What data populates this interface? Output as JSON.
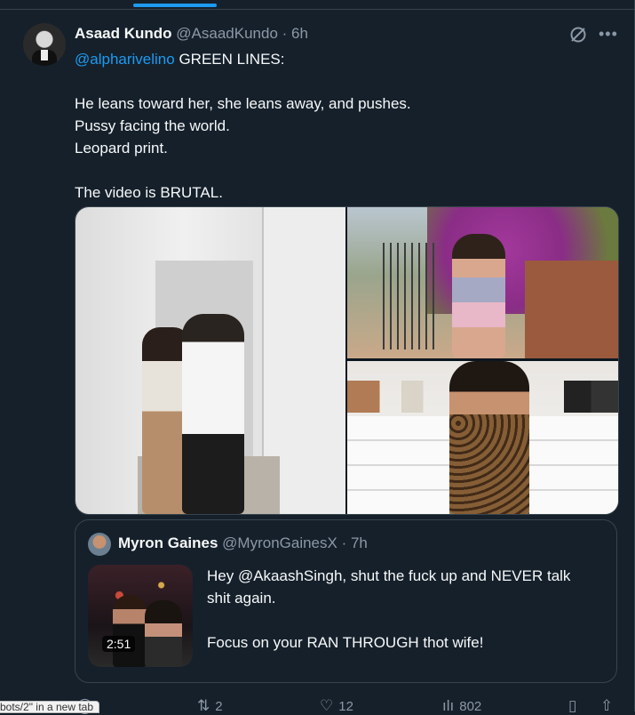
{
  "tweet": {
    "author_name": "Asaad Kundo",
    "author_handle": "@AsaadKundo",
    "time": "· 6h",
    "text_lines": [
      {
        "mention": "@alpharivelino",
        "rest": " GREEN LINES:"
      },
      "",
      "He leans toward her, she leans away, and pushes.",
      "Pussy facing the world.",
      "Leopard print.",
      "",
      "The video is BRUTAL."
    ]
  },
  "quoted": {
    "author_name": "Myron Gaines",
    "author_handle": "@MyronGainesX",
    "time": "· 7h",
    "video_duration": "2:51",
    "text_lines": [
      "Hey @AkaashSingh, shut the fuck up and NEVER talk",
      "shit again.",
      "",
      "Focus on your RAN THROUGH thot wife!"
    ]
  },
  "actions": {
    "replies": "",
    "reposts": "2",
    "likes": "12",
    "views": "802"
  },
  "icons": {
    "grok": "grok-icon",
    "more": "more-icon",
    "reply": "reply-icon",
    "repost": "repost-icon",
    "like": "heart-icon",
    "views": "views-icon",
    "bookmark": "bookmark-icon",
    "share": "share-icon"
  },
  "status_popup": "bots/2\" in a new tab",
  "colors": {
    "background": "#15202b",
    "link": "#1d9bf0",
    "muted": "#8b98a5",
    "border": "#38444d"
  }
}
